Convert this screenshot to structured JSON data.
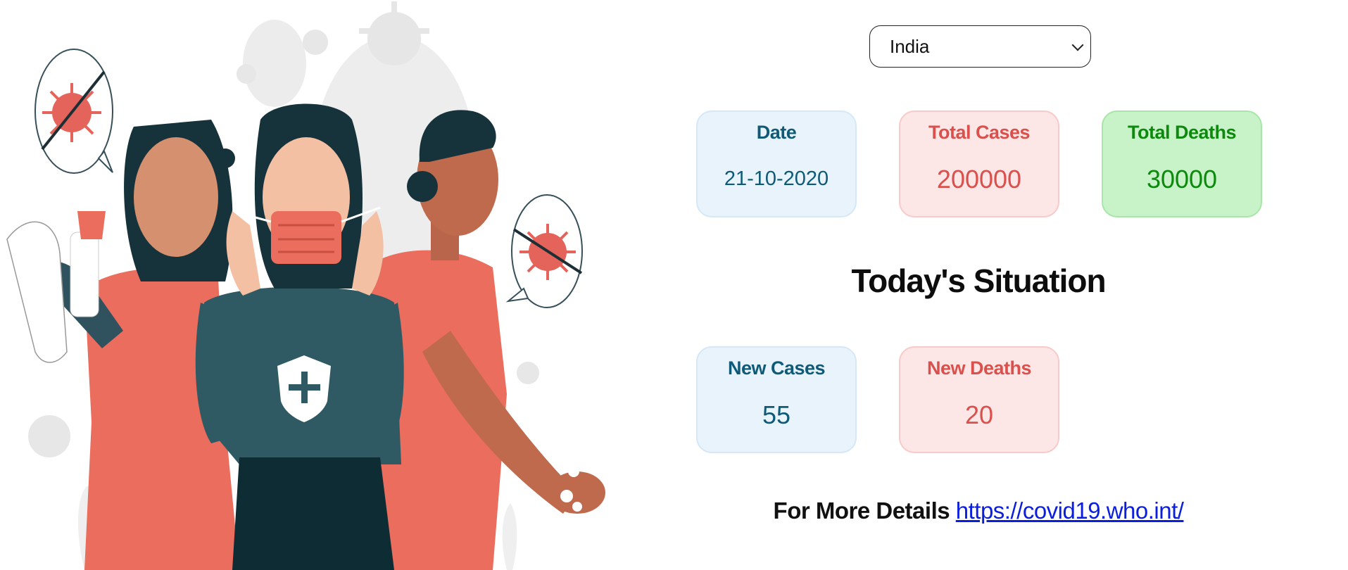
{
  "country_select": {
    "selected": "India"
  },
  "cards": {
    "date": {
      "label": "Date",
      "value": "21-10-2020"
    },
    "total_cases": {
      "label": "Total Cases",
      "value": "200000"
    },
    "total_deaths": {
      "label": "Total Deaths",
      "value": "30000"
    },
    "new_cases": {
      "label": "New Cases",
      "value": "55"
    },
    "new_deaths": {
      "label": "New Deaths",
      "value": "20"
    }
  },
  "section_heading": "Today's Situation",
  "footer": {
    "label": "For More Details",
    "link_text": "https://covid19.who.int/"
  },
  "colors": {
    "blue_card_bg": "#e8f3fc",
    "blue_text": "#0f5a77",
    "red_card_bg": "#fde6e6",
    "red_text": "#d9504c",
    "green_card_bg": "#c8f3c8",
    "green_text": "#0d8a0d",
    "link": "#0b1ee0"
  },
  "illustration": {
    "icons": [
      "virus-icon",
      "mask-icon",
      "shield-plus-icon",
      "spray-bottle-icon",
      "tissue-roll-icon",
      "soap-hands-icon"
    ]
  }
}
